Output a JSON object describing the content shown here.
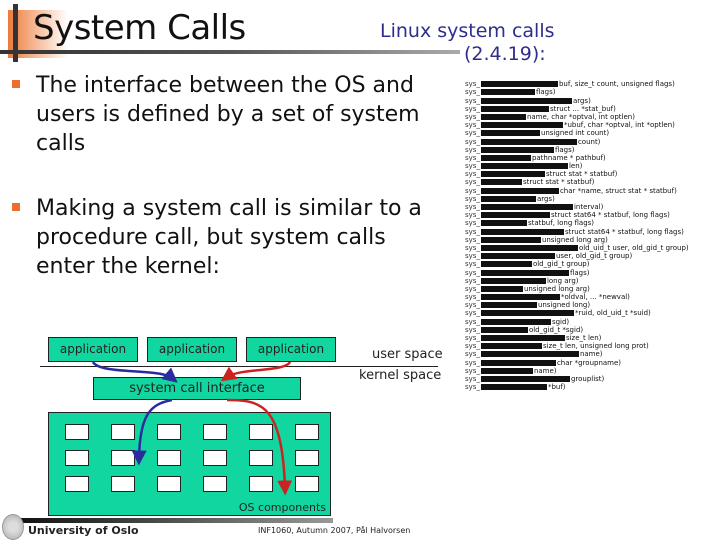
{
  "slide": {
    "title": "System Calls",
    "subtitle_line1": "Linux system calls",
    "subtitle_line2": "(2.4.19):",
    "bullets": [
      "The interface between the OS and users is defined by a set of system calls",
      "Making a system call is similar to a procedure call, but system calls enter the kernel:"
    ]
  },
  "syscall_list": {
    "prefix": "sys_",
    "rows": [
      "",
      "buf, size_t count, unsigned flags)",
      "flags)",
      "args)",
      "struct ... *stat_buf)",
      "name, char *optval, int optlen)",
      "*ubuf, char *optval, int *optlen)",
      "unsigned int count)",
      "count)",
      "flags)",
      "pathname * pathbuf)",
      "len)",
      "struct stat * statbuf)",
      "struct stat * statbuf)",
      "char *name, struct stat * statbuf)",
      "args)",
      "interval)",
      "struct stat64 * statbuf, long flags)",
      "statbuf, long flags)",
      "struct stat64 * statbuf, long flags)",
      "unsigned long arg)",
      "old_uid_t user, old_gid_t group)",
      "user, old_gid_t group)",
      "old_gid_t group)",
      "flags)",
      "long arg)",
      "unsigned long arg)",
      "*oldval, ... *newval)",
      "unsigned long)",
      "*ruid, old_uid_t *suid)",
      "sgid)",
      "old_gid_t *sgid)",
      "size_t len)",
      "size_t len, unsigned long prot)",
      "name)",
      "char *groupname)",
      "name)",
      "grouplist)",
      "*buf)",
      ""
    ]
  },
  "diagram": {
    "applications": [
      "application",
      "application",
      "application"
    ],
    "user_space_label": "user space",
    "kernel_space_label": "kernel space",
    "system_call_interface_label": "system call interface",
    "os_components_label": "OS components",
    "component_grid": {
      "rows": 3,
      "cols": 6
    },
    "colors": {
      "box_fill": "#12d6a0",
      "arrow_left": "#2b2ba0",
      "arrow_right": "#cc2222"
    }
  },
  "footer": {
    "university": "University of Oslo",
    "course_info": "INF1060,  Autumn 2007,  Pål Halvorsen"
  },
  "colors": {
    "accent_orange": "#ee6f2d",
    "subtitle_blue": "#2e2e8a"
  }
}
